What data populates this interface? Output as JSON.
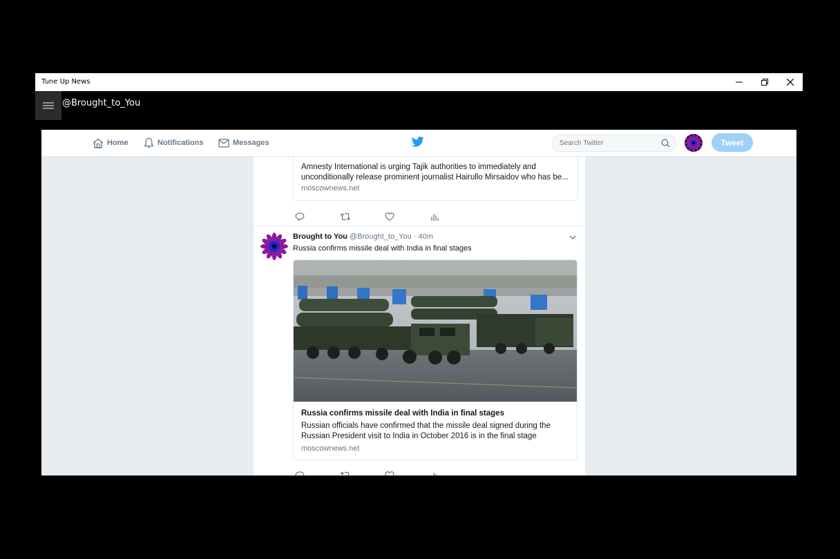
{
  "window": {
    "title": "Tune Up News",
    "controls": [
      "minimize",
      "restore",
      "close"
    ]
  },
  "app": {
    "account": "@Brought_to_You"
  },
  "nav": {
    "home": "Home",
    "notifications": "Notifications",
    "messages": "Messages",
    "search_placeholder": "Search Twitter",
    "tweet_button": "Tweet"
  },
  "colors": {
    "twitter_blue": "#1da1f2",
    "tweet_button_disabled": "#9ed1f7",
    "timeline_bg": "#e6ecf0"
  },
  "tweets": [
    {
      "card": {
        "description": "Amnesty International is urging Tajik authorities to immediately and unconditionally release prominent journalist Hairullo Mirsaidov who has be...",
        "domain": "moscownews.net"
      }
    },
    {
      "author_name": "Brought to You",
      "handle": "@Brought_to_You",
      "time": "· 40m",
      "text": "Russia confirms missile deal with India in final stages",
      "card": {
        "title": "Russia confirms missile deal with India in final stages",
        "description": "Russian officials have confirmed that the missile deal signed during the Russian President visit to India in October 2016 is in the final stage",
        "domain": "moscownews.net"
      }
    }
  ],
  "icons": {
    "home": "home-icon",
    "notifications": "bell-icon",
    "messages": "envelope-icon",
    "search": "search-icon",
    "reply": "reply-icon",
    "retweet": "retweet-icon",
    "like": "heart-icon",
    "analytics": "analytics-icon",
    "menu": "hamburger-icon",
    "caret": "chevron-down-icon"
  }
}
